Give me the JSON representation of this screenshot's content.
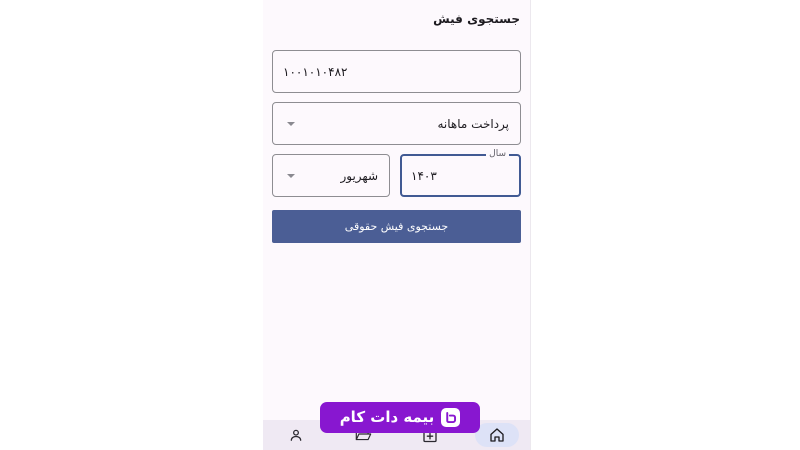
{
  "header": {
    "title": "جستجوی فیش"
  },
  "form": {
    "personnel_id": {
      "value": "۱۰۰۱۰۱۰۴۸۲"
    },
    "payment_type": {
      "selected": "پرداخت ماهانه"
    },
    "month": {
      "selected": "شهریور"
    },
    "year": {
      "label": "سال",
      "value": "۱۴۰۳"
    },
    "search_button_label": "جستجوی فیش حقوقی"
  },
  "bottom_nav": {
    "items": [
      {
        "icon": "home-icon",
        "active": true
      },
      {
        "icon": "add-box-icon",
        "active": false
      },
      {
        "icon": "folder-icon",
        "active": false
      },
      {
        "icon": "person-icon",
        "active": false
      }
    ]
  },
  "watermark": {
    "brand_name": "بیمه دات کام"
  },
  "colors": {
    "primary_button": "#4b5e95",
    "focused_border": "#415a93",
    "watermark_bg": "#8817d0",
    "active_nav_pill": "#dde2f7"
  }
}
